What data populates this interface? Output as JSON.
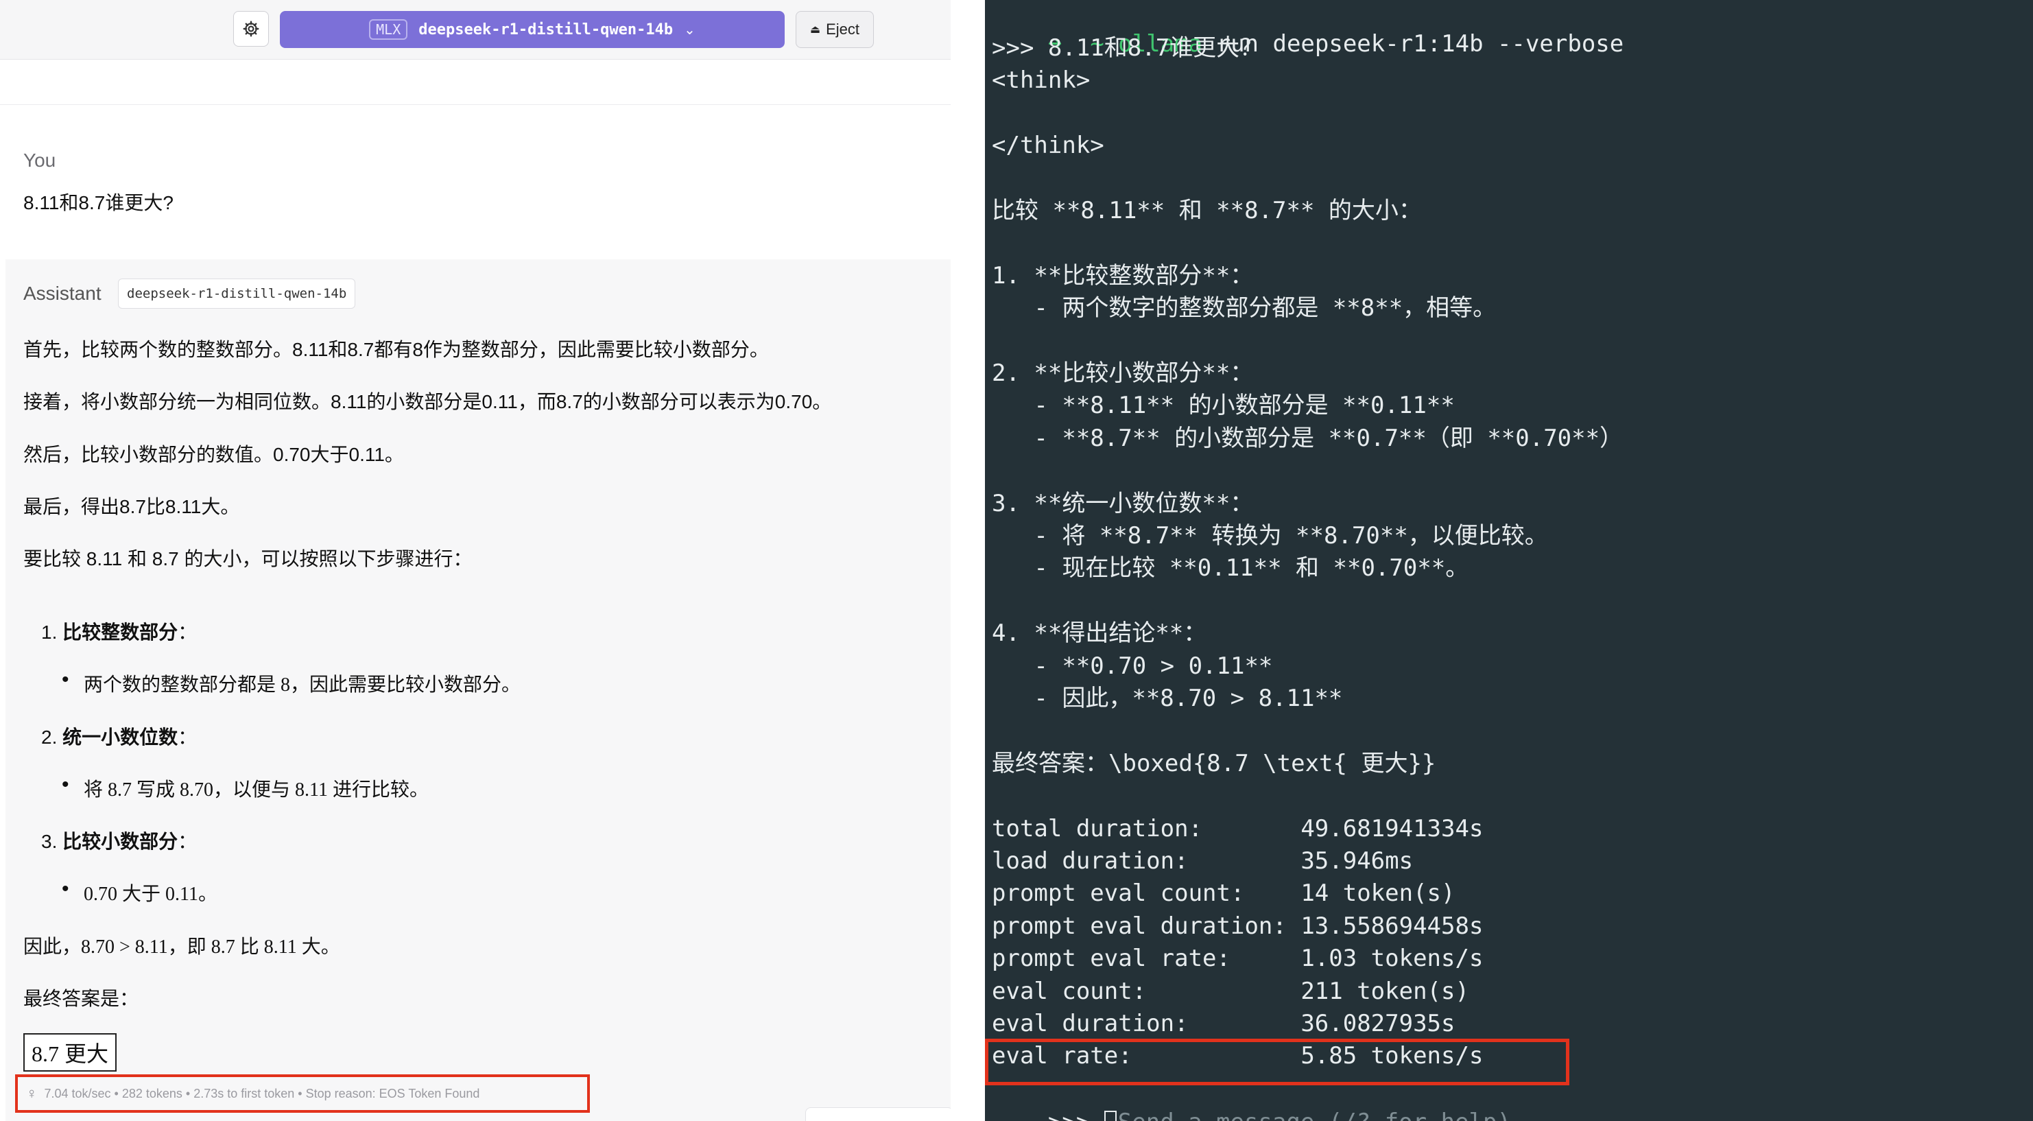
{
  "left": {
    "model_badge": "MLX",
    "model_name": "deepseek-r1-distill-qwen-14b",
    "eject_label": "Eject",
    "user_role": "You",
    "user_message": "8.11和8.7谁更大?",
    "assistant_role": "Assistant",
    "assistant_model": "deepseek-r1-distill-qwen-14b",
    "paragraphs": [
      "首先，比较两个数的整数部分。8.11和8.7都有8作为整数部分，因此需要比较小数部分。",
      "接着，将小数部分统一为相同位数。8.11的小数部分是0.11，而8.7的小数部分可以表示为0.70。",
      "然后，比较小数部分的数值。0.70大于0.11。",
      "最后，得出8.7比8.11大。",
      "要比较 8.11 和 8.7 的大小，可以按照以下步骤进行："
    ],
    "steps": [
      {
        "num": "1.",
        "title": "比较整数部分",
        "colon": "：",
        "bullet": "两个数的整数部分都是 8，因此需要比较小数部分。"
      },
      {
        "num": "2.",
        "title": "统一小数位数",
        "colon": "：",
        "bullet": "将 8.7 写成 8.70，以便与 8.11 进行比较。"
      },
      {
        "num": "3.",
        "title": "比较小数部分",
        "colon": "：",
        "bullet": "0.70 大于 0.11。"
      }
    ],
    "conclusion": "因此，8.70 > 8.11，即 8.7 比 8.11 大。",
    "final_label": "最终答案是：",
    "final_answer": "8.7 更大",
    "stats": "7.04 tok/sec  •  282 tokens  •  2.73s to first token  •  Stop reason: EOS Token Found"
  },
  "terminal": {
    "prompt_arrow": "➜",
    "tilde": "~",
    "cmd_program": "ollama",
    "cmd_args": "run deepseek-r1:14b --verbose",
    "lines": [
      ">>> 8.11和8.7谁更大？",
      "<think>",
      "",
      "</think>",
      "",
      "比较 **8.11** 和 **8.7** 的大小：",
      "",
      "1. **比较整数部分**：",
      "   - 两个数字的整数部分都是 **8**，相等。",
      "",
      "2. **比较小数部分**：",
      "   - **8.11** 的小数部分是 **0.11**",
      "   - **8.7** 的小数部分是 **0.7**（即 **0.70**）",
      "",
      "3. **统一小数位数**：",
      "   - 将 **8.7** 转换为 **8.70**，以便比较。",
      "   - 现在比较 **0.11** 和 **0.70**。",
      "",
      "4. **得出结论**：",
      "   - **0.70 > 0.11**",
      "   - 因此，**8.70 > 8.11**",
      "",
      "最终答案：\\boxed{8.7 \\text{ 更大}}",
      "",
      "total duration:       49.681941334s",
      "load duration:        35.946ms",
      "prompt eval count:    14 token(s)",
      "prompt eval duration: 13.558694458s",
      "prompt eval rate:     1.03 tokens/s",
      "eval count:           211 token(s)",
      "eval duration:        36.0827935s",
      "eval rate:            5.85 tokens/s"
    ],
    "input_prompt": ">>> ",
    "input_placeholder": "Send a message (/? for help)"
  }
}
